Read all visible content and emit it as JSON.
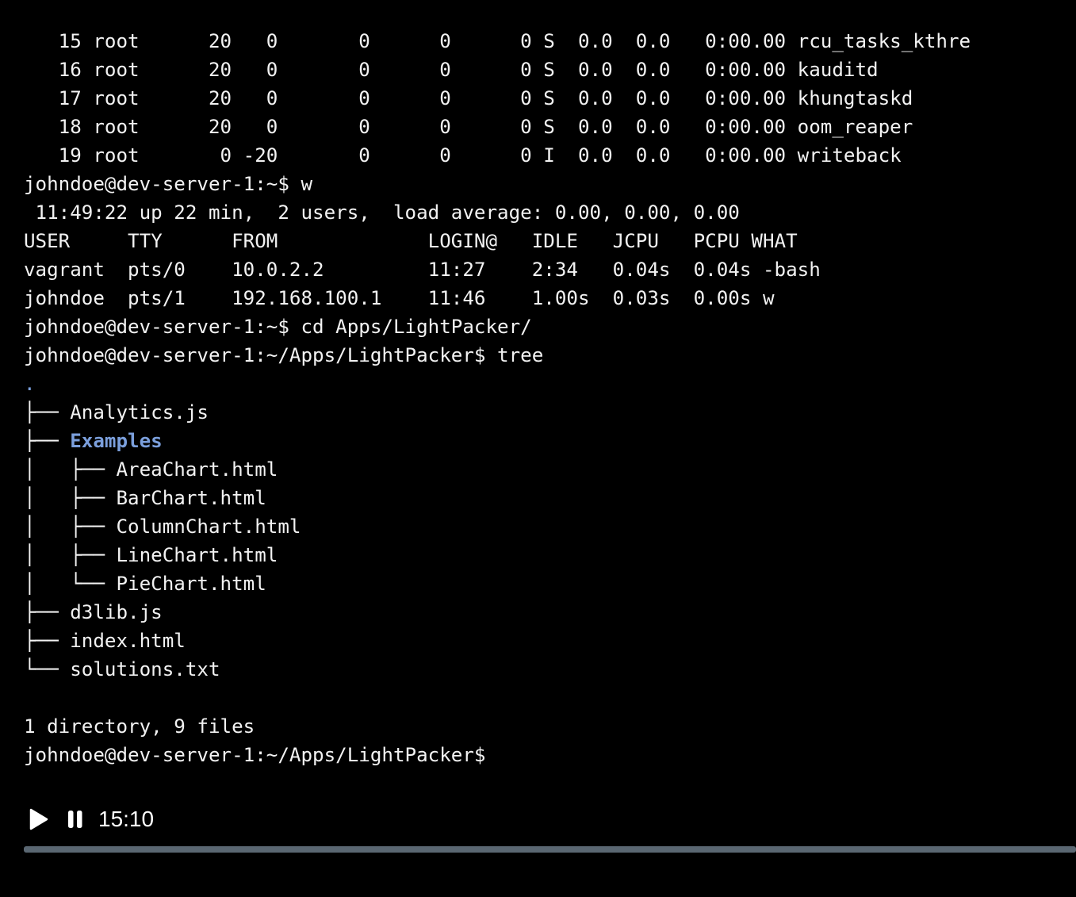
{
  "terminal": {
    "lines": [
      {
        "text": "   15 root      20   0       0      0      0 S  0.0  0.0   0:00.00 rcu_tasks_kthre"
      },
      {
        "text": "   16 root      20   0       0      0      0 S  0.0  0.0   0:00.00 kauditd"
      },
      {
        "text": "   17 root      20   0       0      0      0 S  0.0  0.0   0:00.00 khungtaskd"
      },
      {
        "text": "   18 root      20   0       0      0      0 S  0.0  0.0   0:00.00 oom_reaper"
      },
      {
        "text": "   19 root       0 -20       0      0      0 I  0.0  0.0   0:00.00 writeback"
      },
      {
        "text": "johndoe@dev-server-1:~$ w"
      },
      {
        "text": " 11:49:22 up 22 min,  2 users,  load average: 0.00, 0.00, 0.00"
      },
      {
        "text": "USER     TTY      FROM             LOGIN@   IDLE   JCPU   PCPU WHAT"
      },
      {
        "text": "vagrant  pts/0    10.0.2.2         11:27    2:34   0.04s  0.04s -bash"
      },
      {
        "text": "johndoe  pts/1    192.168.100.1    11:46    1.00s  0.03s  0.00s w"
      },
      {
        "text": "johndoe@dev-server-1:~$ cd Apps/LightPacker/"
      },
      {
        "text": "johndoe@dev-server-1:~/Apps/LightPacker$ tree"
      },
      {
        "text": ".",
        "style": "dot"
      },
      {
        "prefix": "├── ",
        "text": "Analytics.js"
      },
      {
        "prefix": "├── ",
        "text": "Examples",
        "style": "dir"
      },
      {
        "prefix": "│   ├── ",
        "text": "AreaChart.html"
      },
      {
        "prefix": "│   ├── ",
        "text": "BarChart.html"
      },
      {
        "prefix": "│   ├── ",
        "text": "ColumnChart.html"
      },
      {
        "prefix": "│   ├── ",
        "text": "LineChart.html"
      },
      {
        "prefix": "│   └── ",
        "text": "PieChart.html"
      },
      {
        "prefix": "├── ",
        "text": "d3lib.js"
      },
      {
        "prefix": "├── ",
        "text": "index.html"
      },
      {
        "prefix": "└── ",
        "text": "solutions.txt"
      },
      {
        "text": ""
      },
      {
        "text": "1 directory, 9 files"
      },
      {
        "text": "johndoe@dev-server-1:~/Apps/LightPacker$"
      }
    ]
  },
  "player": {
    "play_icon": "play-icon",
    "pause_icon": "pause-icon",
    "timestamp": "15:10",
    "progress_fraction": 1.0,
    "track_color": "#5a6772"
  },
  "colors": {
    "background": "#000000",
    "text": "#f2f2f2",
    "directory": "#7b9fdc"
  }
}
